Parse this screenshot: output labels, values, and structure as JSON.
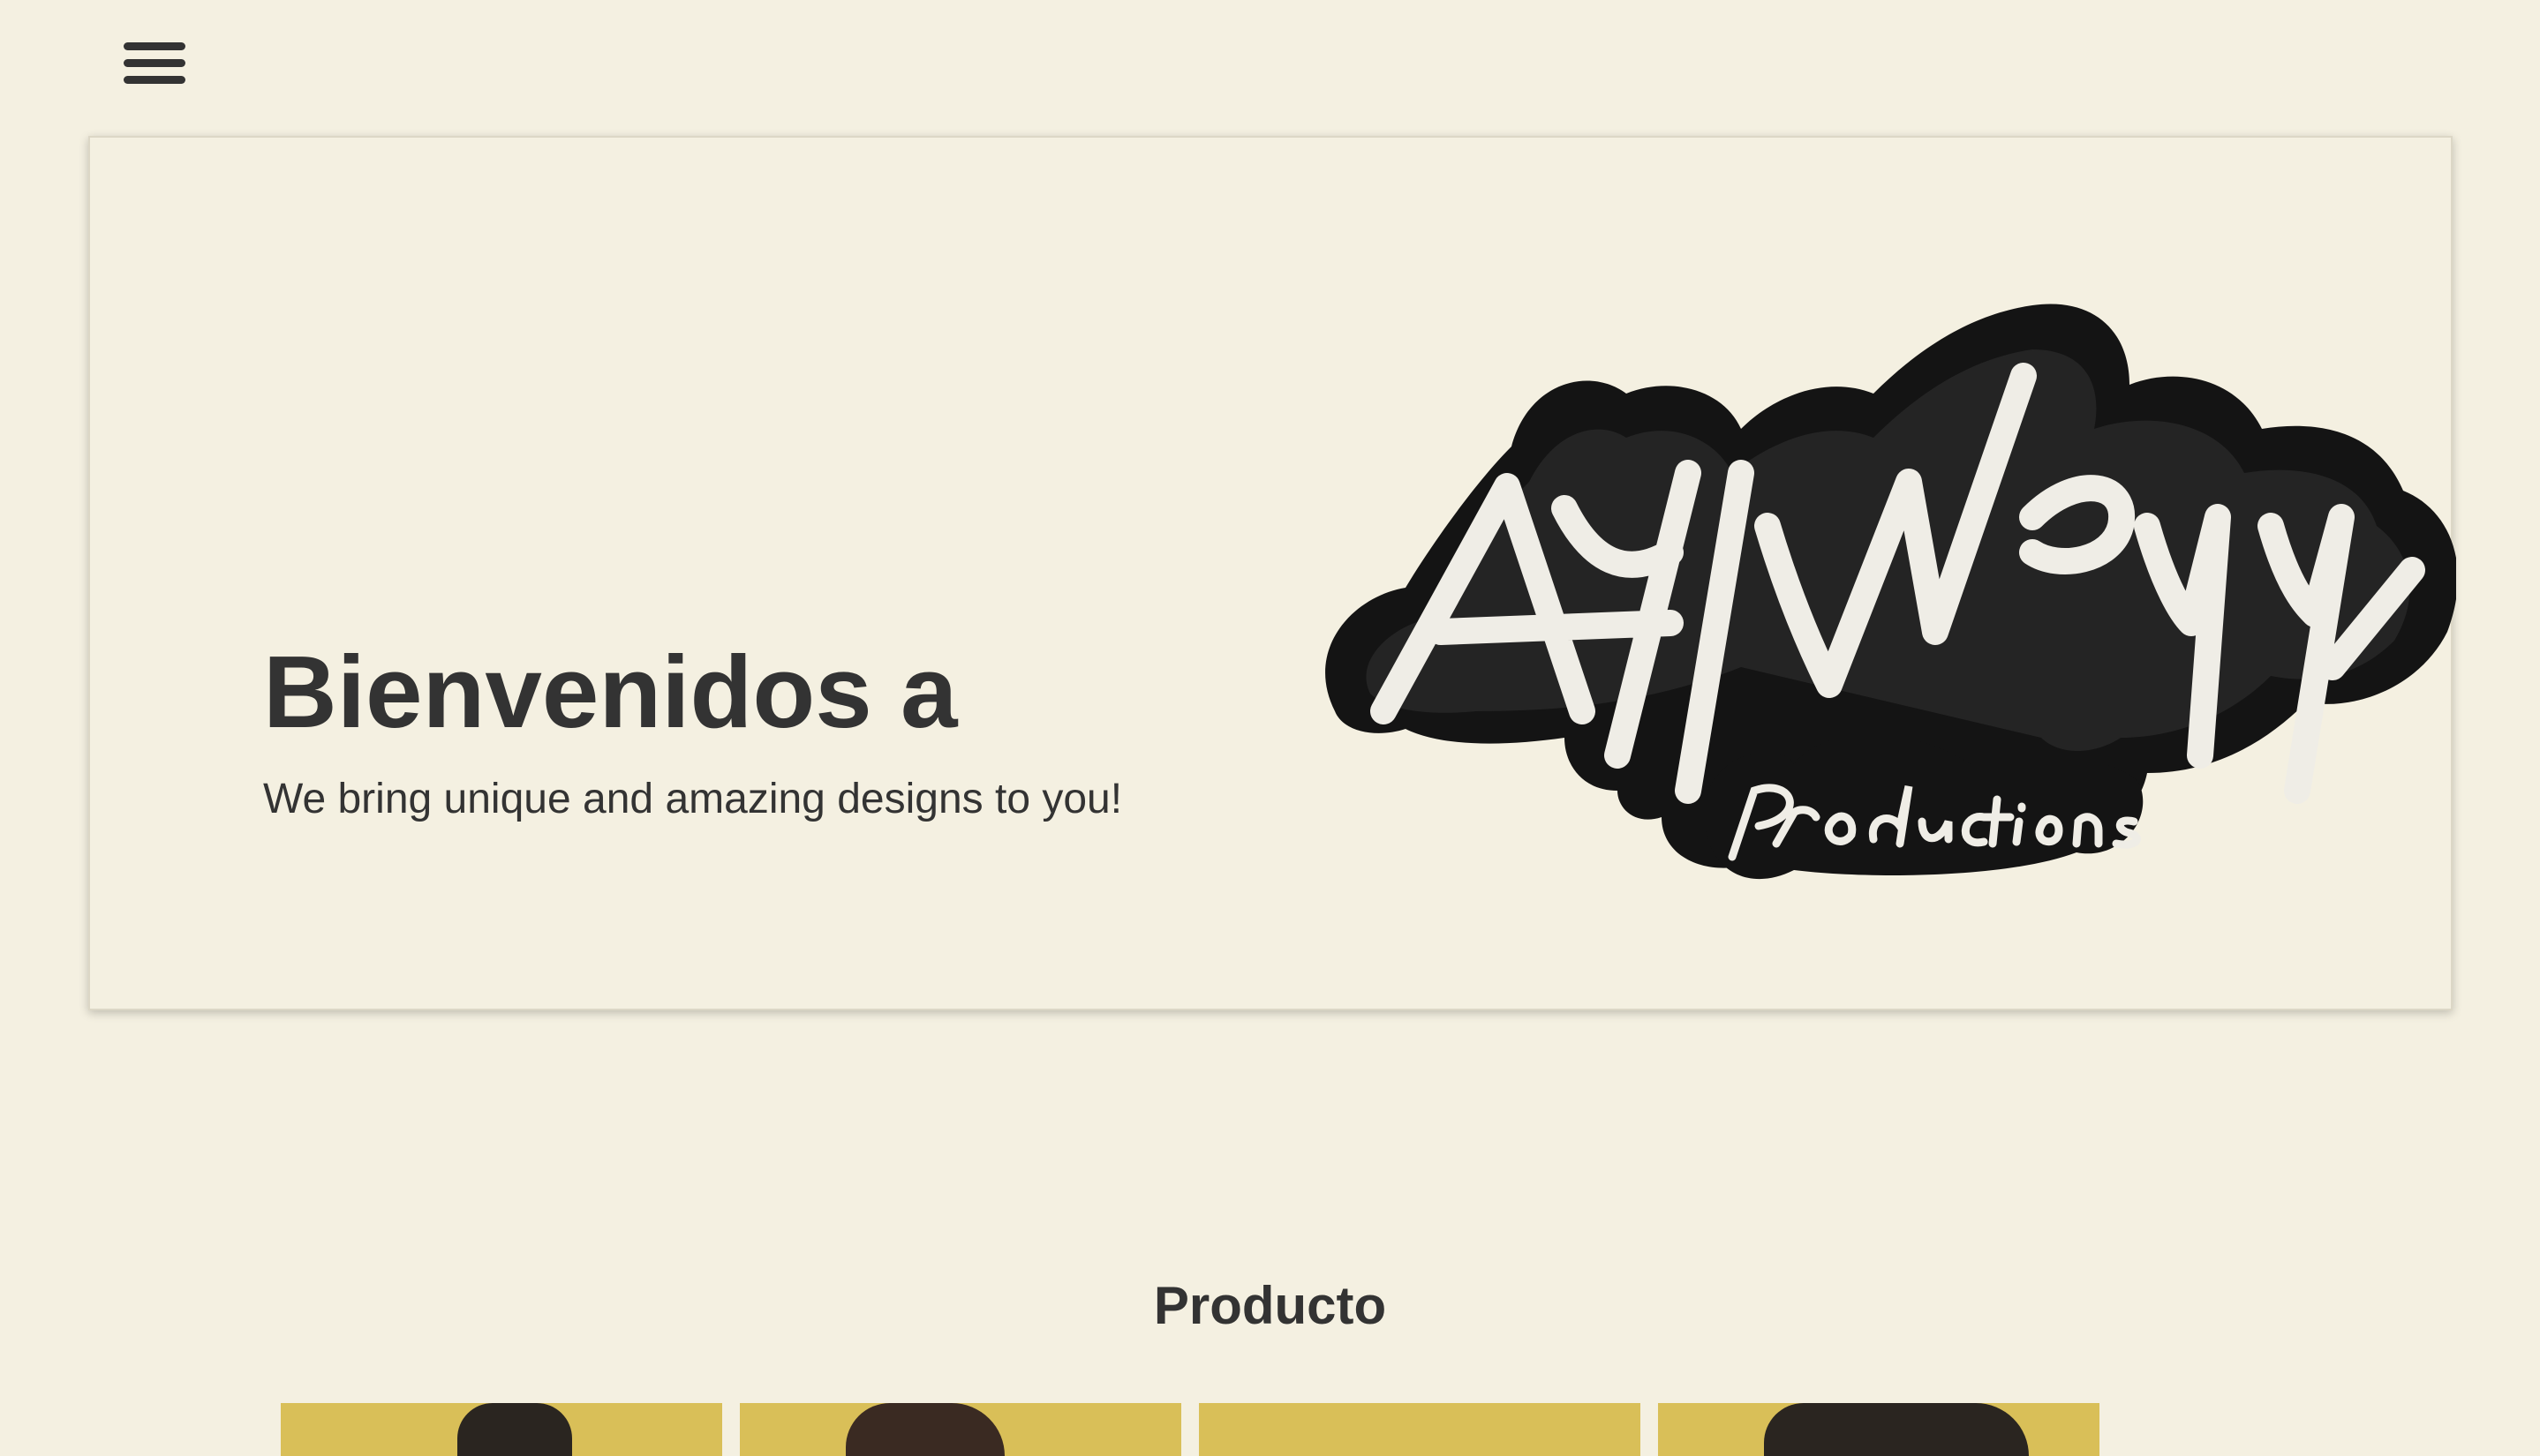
{
  "nav": {
    "menu_icon": "hamburger-menu-icon"
  },
  "hero": {
    "title": "Bienvenidos a",
    "subtitle": "We bring unique and amazing designs to you!",
    "logo": {
      "main_text": "AyWey",
      "sub_text": "Productions"
    }
  },
  "products": {
    "title": "Producto",
    "items": [
      {
        "image": "product-image"
      },
      {
        "image": "product-image"
      },
      {
        "image": "product-image"
      },
      {
        "image": "product-image"
      }
    ]
  },
  "colors": {
    "background": "#f4f0e1",
    "text": "#333333",
    "product_background": "#d9bf58"
  }
}
